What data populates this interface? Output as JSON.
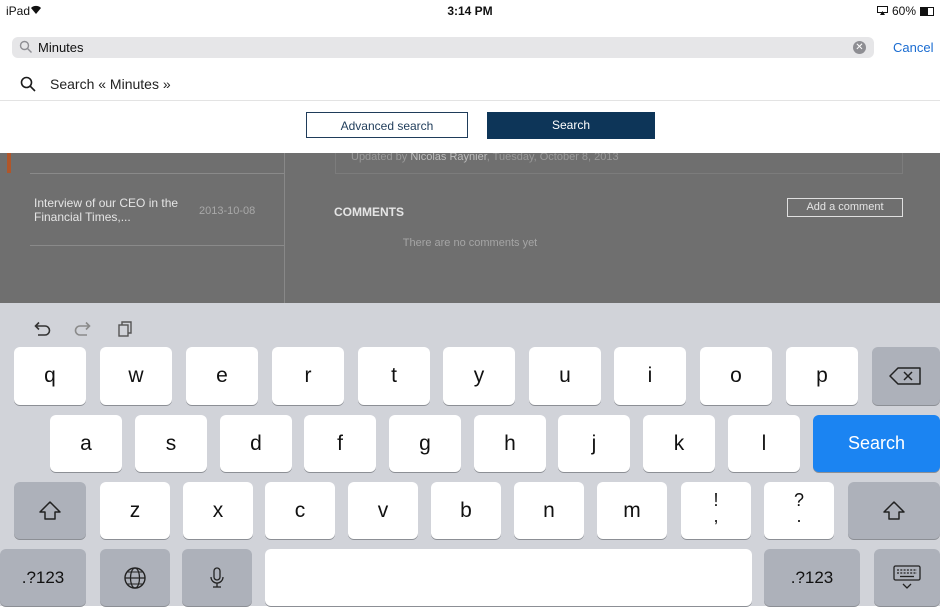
{
  "status_bar": {
    "device": "iPad",
    "time": "3:14 PM",
    "battery": "60%"
  },
  "search": {
    "value": "Minutes",
    "cancel_label": "Cancel"
  },
  "suggestion": {
    "label": "Search « Minutes »"
  },
  "buttons": {
    "advanced": "Advanced search",
    "search": "Search"
  },
  "background": {
    "updated_prefix": "Updated by ",
    "updated_author": "Nicolas Raynier",
    "updated_suffix": ", Tuesday, October 8, 2013",
    "news_title": "Interview of our CEO in the Financial Times,...",
    "news_date": "2013-10-08",
    "comments_heading": "COMMENTS",
    "add_comment": "Add a comment",
    "no_comments": "There are no comments yet"
  },
  "keyboard": {
    "row1": [
      "q",
      "w",
      "e",
      "r",
      "t",
      "y",
      "u",
      "i",
      "o",
      "p"
    ],
    "row2": [
      "a",
      "s",
      "d",
      "f",
      "g",
      "h",
      "j",
      "k",
      "l"
    ],
    "row3": [
      "z",
      "x",
      "c",
      "v",
      "b",
      "n",
      "m"
    ],
    "punct1_top": "!",
    "punct1_bottom": ",",
    "punct2_top": "?",
    "punct2_bottom": ".",
    "search_key": "Search",
    "numbers_key": ".?123"
  },
  "colors": {
    "accent_blue": "#1b84f2",
    "search_button": "#0d3558",
    "cancel": "#1a6cd1"
  }
}
